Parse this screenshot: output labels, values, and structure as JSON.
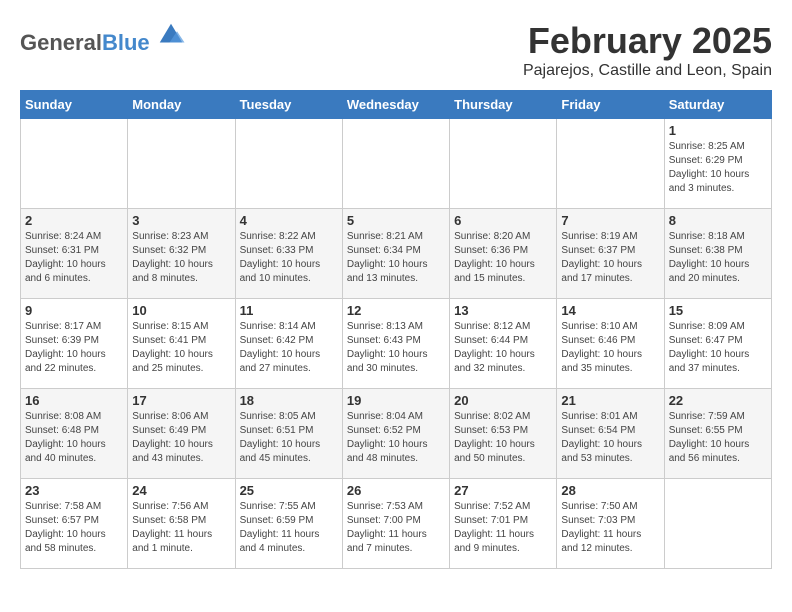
{
  "header": {
    "logo_general": "General",
    "logo_blue": "Blue",
    "month": "February 2025",
    "location": "Pajarejos, Castille and Leon, Spain"
  },
  "weekdays": [
    "Sunday",
    "Monday",
    "Tuesday",
    "Wednesday",
    "Thursday",
    "Friday",
    "Saturday"
  ],
  "weeks": [
    [
      {
        "day": "",
        "info": ""
      },
      {
        "day": "",
        "info": ""
      },
      {
        "day": "",
        "info": ""
      },
      {
        "day": "",
        "info": ""
      },
      {
        "day": "",
        "info": ""
      },
      {
        "day": "",
        "info": ""
      },
      {
        "day": "1",
        "info": "Sunrise: 8:25 AM\nSunset: 6:29 PM\nDaylight: 10 hours and 3 minutes."
      }
    ],
    [
      {
        "day": "2",
        "info": "Sunrise: 8:24 AM\nSunset: 6:31 PM\nDaylight: 10 hours and 6 minutes."
      },
      {
        "day": "3",
        "info": "Sunrise: 8:23 AM\nSunset: 6:32 PM\nDaylight: 10 hours and 8 minutes."
      },
      {
        "day": "4",
        "info": "Sunrise: 8:22 AM\nSunset: 6:33 PM\nDaylight: 10 hours and 10 minutes."
      },
      {
        "day": "5",
        "info": "Sunrise: 8:21 AM\nSunset: 6:34 PM\nDaylight: 10 hours and 13 minutes."
      },
      {
        "day": "6",
        "info": "Sunrise: 8:20 AM\nSunset: 6:36 PM\nDaylight: 10 hours and 15 minutes."
      },
      {
        "day": "7",
        "info": "Sunrise: 8:19 AM\nSunset: 6:37 PM\nDaylight: 10 hours and 17 minutes."
      },
      {
        "day": "8",
        "info": "Sunrise: 8:18 AM\nSunset: 6:38 PM\nDaylight: 10 hours and 20 minutes."
      }
    ],
    [
      {
        "day": "9",
        "info": "Sunrise: 8:17 AM\nSunset: 6:39 PM\nDaylight: 10 hours and 22 minutes."
      },
      {
        "day": "10",
        "info": "Sunrise: 8:15 AM\nSunset: 6:41 PM\nDaylight: 10 hours and 25 minutes."
      },
      {
        "day": "11",
        "info": "Sunrise: 8:14 AM\nSunset: 6:42 PM\nDaylight: 10 hours and 27 minutes."
      },
      {
        "day": "12",
        "info": "Sunrise: 8:13 AM\nSunset: 6:43 PM\nDaylight: 10 hours and 30 minutes."
      },
      {
        "day": "13",
        "info": "Sunrise: 8:12 AM\nSunset: 6:44 PM\nDaylight: 10 hours and 32 minutes."
      },
      {
        "day": "14",
        "info": "Sunrise: 8:10 AM\nSunset: 6:46 PM\nDaylight: 10 hours and 35 minutes."
      },
      {
        "day": "15",
        "info": "Sunrise: 8:09 AM\nSunset: 6:47 PM\nDaylight: 10 hours and 37 minutes."
      }
    ],
    [
      {
        "day": "16",
        "info": "Sunrise: 8:08 AM\nSunset: 6:48 PM\nDaylight: 10 hours and 40 minutes."
      },
      {
        "day": "17",
        "info": "Sunrise: 8:06 AM\nSunset: 6:49 PM\nDaylight: 10 hours and 43 minutes."
      },
      {
        "day": "18",
        "info": "Sunrise: 8:05 AM\nSunset: 6:51 PM\nDaylight: 10 hours and 45 minutes."
      },
      {
        "day": "19",
        "info": "Sunrise: 8:04 AM\nSunset: 6:52 PM\nDaylight: 10 hours and 48 minutes."
      },
      {
        "day": "20",
        "info": "Sunrise: 8:02 AM\nSunset: 6:53 PM\nDaylight: 10 hours and 50 minutes."
      },
      {
        "day": "21",
        "info": "Sunrise: 8:01 AM\nSunset: 6:54 PM\nDaylight: 10 hours and 53 minutes."
      },
      {
        "day": "22",
        "info": "Sunrise: 7:59 AM\nSunset: 6:55 PM\nDaylight: 10 hours and 56 minutes."
      }
    ],
    [
      {
        "day": "23",
        "info": "Sunrise: 7:58 AM\nSunset: 6:57 PM\nDaylight: 10 hours and 58 minutes."
      },
      {
        "day": "24",
        "info": "Sunrise: 7:56 AM\nSunset: 6:58 PM\nDaylight: 11 hours and 1 minute."
      },
      {
        "day": "25",
        "info": "Sunrise: 7:55 AM\nSunset: 6:59 PM\nDaylight: 11 hours and 4 minutes."
      },
      {
        "day": "26",
        "info": "Sunrise: 7:53 AM\nSunset: 7:00 PM\nDaylight: 11 hours and 7 minutes."
      },
      {
        "day": "27",
        "info": "Sunrise: 7:52 AM\nSunset: 7:01 PM\nDaylight: 11 hours and 9 minutes."
      },
      {
        "day": "28",
        "info": "Sunrise: 7:50 AM\nSunset: 7:03 PM\nDaylight: 11 hours and 12 minutes."
      },
      {
        "day": "",
        "info": ""
      }
    ]
  ]
}
